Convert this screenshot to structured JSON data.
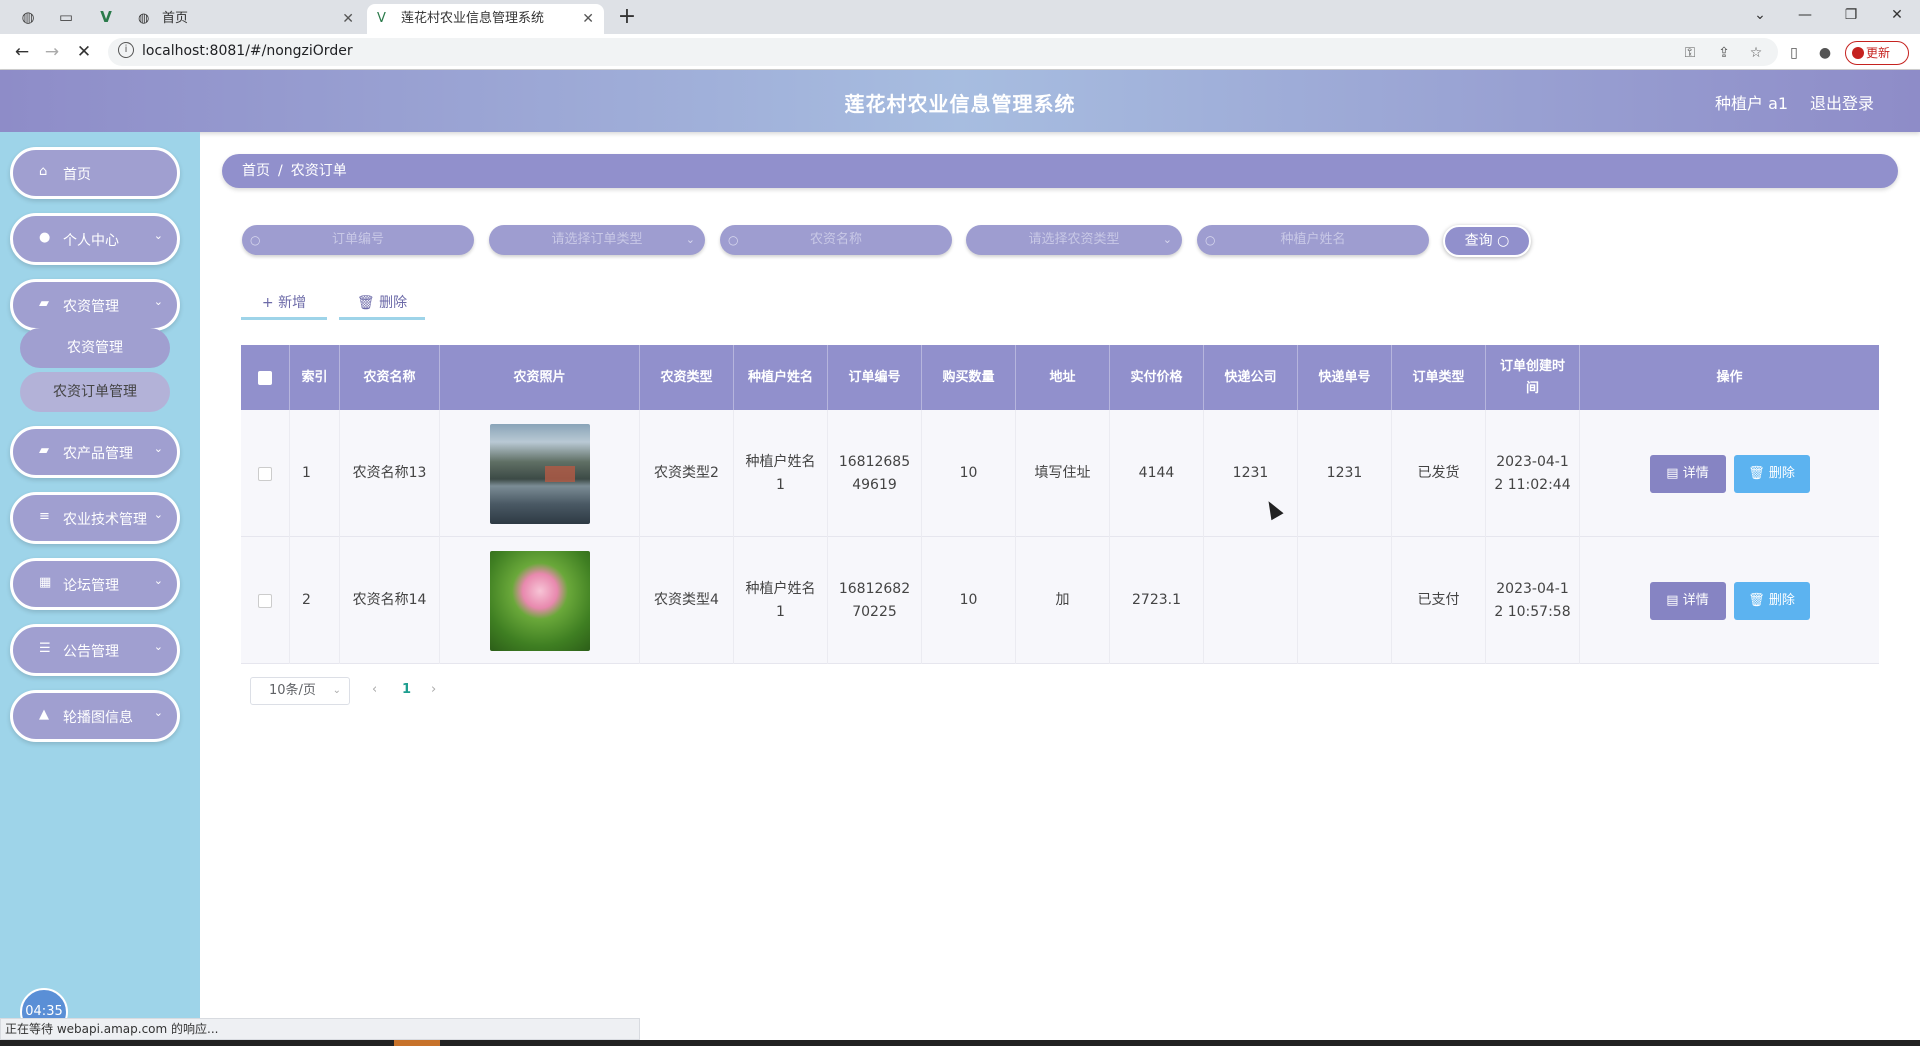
{
  "browser": {
    "tabs": [
      {
        "title": "首页"
      },
      {
        "title": "莲花村农业信息管理系统"
      }
    ],
    "url": "localhost:8081/#/nongziOrder",
    "update_label": "更新",
    "status_text": "正在等待 webapi.amap.com 的响应..."
  },
  "header": {
    "title": "莲花村农业信息管理系统",
    "user": "种植户 a1",
    "logout": "退出登录"
  },
  "sidebar": {
    "items": [
      {
        "label": "首页",
        "icon": "home-icon"
      },
      {
        "label": "个人中心",
        "icon": "user-icon"
      },
      {
        "label": "农资管理",
        "icon": "chat-icon"
      },
      {
        "label": "农产品管理",
        "icon": "car-icon"
      },
      {
        "label": "农业技术管理",
        "icon": "list-icon"
      },
      {
        "label": "论坛管理",
        "icon": "grid-icon"
      },
      {
        "label": "公告管理",
        "icon": "sliders-icon"
      },
      {
        "label": "轮播图信息",
        "icon": "thumb-icon"
      }
    ],
    "subitems": [
      "农资管理",
      "农资订单管理"
    ],
    "clock": "04:35"
  },
  "breadcrumb": {
    "home": "首页",
    "current": "农资订单"
  },
  "search": {
    "order_no_placeholder": "订单编号",
    "order_type_placeholder": "请选择订单类型",
    "name_placeholder": "农资名称",
    "nongzi_type_placeholder": "请选择农资类型",
    "farmer_placeholder": "种植户姓名",
    "query_label": "查询"
  },
  "actions": {
    "add": "新增",
    "delete": "删除"
  },
  "table": {
    "headers": [
      "索引",
      "农资名称",
      "农资照片",
      "农资类型",
      "种植户姓名",
      "订单编号",
      "购买数量",
      "地址",
      "实付价格",
      "快递公司",
      "快递单号",
      "订单类型",
      "订单创建时间",
      "操作"
    ],
    "rows": [
      {
        "index": "1",
        "name": "农资名称13",
        "image": "mountain-lake",
        "type": "农资类型2",
        "farmer": "种植户姓名1",
        "order_no": "1681268549619",
        "qty": "10",
        "address": "填写住址",
        "price": "4144",
        "courier": "1231",
        "tracking": "1231",
        "order_type": "已发货",
        "created": "2023-04-12 11:02:44"
      },
      {
        "index": "2",
        "name": "农资名称14",
        "image": "lotus",
        "type": "农资类型4",
        "farmer": "种植户姓名1",
        "order_no": "1681268270225",
        "qty": "10",
        "address": "加",
        "price": "2723.1",
        "courier": "",
        "tracking": "",
        "order_type": "已支付",
        "created": "2023-04-12 10:57:58"
      }
    ],
    "detail_label": "详情",
    "delete_label": "删除"
  },
  "pagination": {
    "page_size": "10条/页",
    "current_page": "1"
  },
  "colors": {
    "accent": "#9190cc",
    "sidebar": "#9ed4e9",
    "delete": "#5cb3f0"
  }
}
